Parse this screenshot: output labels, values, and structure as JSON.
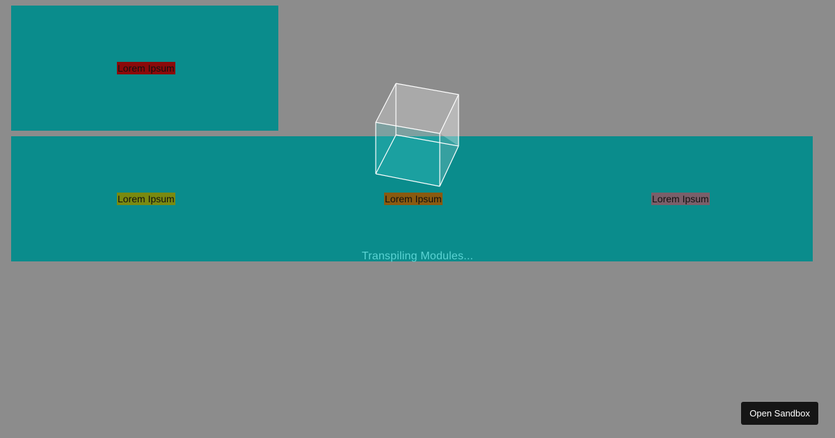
{
  "panels": {
    "top": {
      "label": "Lorem Ipsum"
    },
    "wide": {
      "labels": [
        "Lorem Ipsum",
        "Lorem Ipsum",
        "Lorem Ipsum"
      ]
    }
  },
  "loader": {
    "icon": "cube-icon",
    "text": "Transpiling Modules..."
  },
  "open_sandbox_label": "Open Sandbox",
  "colors": {
    "background": "#8c8c8c",
    "panel": "#0a8c8c",
    "label_red": "#8b0a0a",
    "label_olive": "#7a8a10",
    "label_orange": "#8a5a10",
    "label_mauve": "#7a5f6a",
    "loader_text": "#5ad3d3",
    "button_bg": "#151515"
  }
}
